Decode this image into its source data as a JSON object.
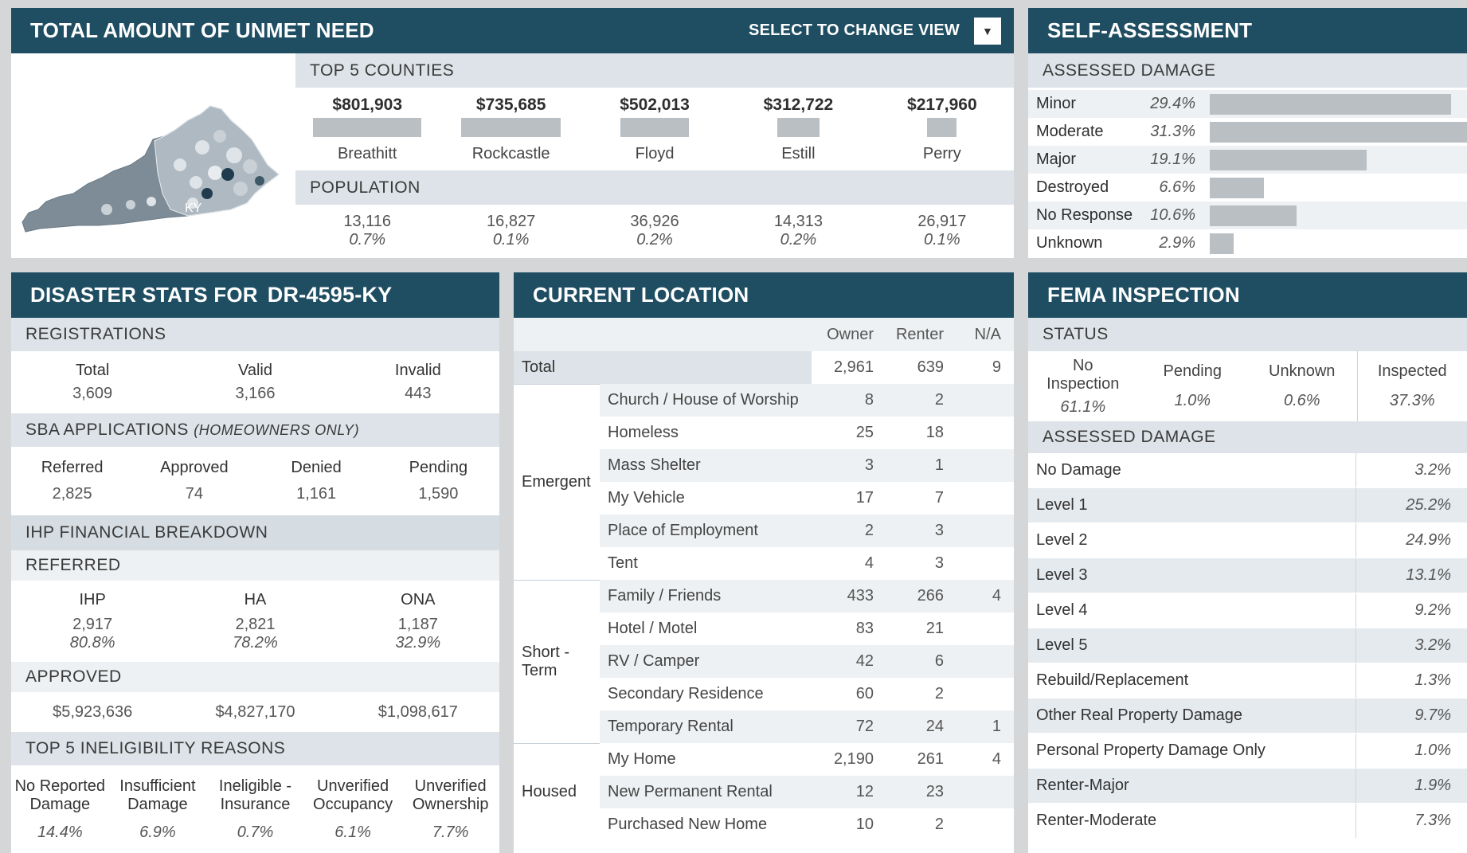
{
  "unmet": {
    "title": "TOTAL AMOUNT OF UNMET NEED",
    "view_label": "SELECT TO CHANGE VIEW",
    "map_label": "KY",
    "top_counties_label": "TOP 5 COUNTIES",
    "population_label": "POPULATION",
    "counties": [
      {
        "amount": "$801,903",
        "name": "Breathitt",
        "pop": "13,116",
        "pct": "0.7%",
        "share": 1.0
      },
      {
        "amount": "$735,685",
        "name": "Rockcastle",
        "pop": "16,827",
        "pct": "0.1%",
        "share": 0.92
      },
      {
        "amount": "$502,013",
        "name": "Floyd",
        "pop": "36,926",
        "pct": "0.2%",
        "share": 0.63
      },
      {
        "amount": "$312,722",
        "name": "Estill",
        "pop": "14,313",
        "pct": "0.2%",
        "share": 0.39
      },
      {
        "amount": "$217,960",
        "name": "Perry",
        "pop": "26,917",
        "pct": "0.1%",
        "share": 0.27
      }
    ]
  },
  "self": {
    "title": "SELF-ASSESSMENT",
    "sub": "ASSESSED DAMAGE",
    "rows": [
      {
        "label": "Minor",
        "pct": "29.4%",
        "value": 29.4
      },
      {
        "label": "Moderate",
        "pct": "31.3%",
        "value": 31.3
      },
      {
        "label": "Major",
        "pct": "19.1%",
        "value": 19.1
      },
      {
        "label": "Destroyed",
        "pct": "6.6%",
        "value": 6.6
      },
      {
        "label": "No Response",
        "pct": "10.6%",
        "value": 10.6
      },
      {
        "label": "Unknown",
        "pct": "2.9%",
        "value": 2.9
      }
    ]
  },
  "stats": {
    "title": "DISASTER STATS FOR",
    "disaster": "DR-4595-KY",
    "registrations": {
      "label": "REGISTRATIONS",
      "cols": [
        {
          "label": "Total",
          "value": "3,609"
        },
        {
          "label": "Valid",
          "value": "3,166"
        },
        {
          "label": "Invalid",
          "value": "443"
        }
      ]
    },
    "sba": {
      "label": "SBA APPLICATIONS",
      "qualifier": "(HOMEOWNERS ONLY)",
      "cols": [
        {
          "label": "Referred",
          "value": "2,825"
        },
        {
          "label": "Approved",
          "value": "74"
        },
        {
          "label": "Denied",
          "value": "1,161"
        },
        {
          "label": "Pending",
          "value": "1,590"
        }
      ]
    },
    "ihp": {
      "label": "IHP FINANCIAL BREAKDOWN",
      "referred_label": "REFERRED",
      "referred": [
        {
          "label": "IHP",
          "value": "2,917",
          "pct": "80.8%"
        },
        {
          "label": "HA",
          "value": "2,821",
          "pct": "78.2%"
        },
        {
          "label": "ONA",
          "value": "1,187",
          "pct": "32.9%"
        }
      ],
      "approved_label": "APPROVED",
      "approved": [
        "$5,923,636",
        "$4,827,170",
        "$1,098,617"
      ]
    },
    "inelig": {
      "label": "TOP 5 INELIGIBILITY REASONS",
      "cols": [
        {
          "l1": "No Reported",
          "l2": "Damage",
          "pct": "14.4%"
        },
        {
          "l1": "Insufficient",
          "l2": "Damage",
          "pct": "6.9%"
        },
        {
          "l1": "Ineligible -",
          "l2": "Insurance",
          "pct": "0.7%"
        },
        {
          "l1": "Unverified",
          "l2": "Occupancy",
          "pct": "6.1%"
        },
        {
          "l1": "Unverified",
          "l2": "Ownership",
          "pct": "7.7%"
        }
      ]
    }
  },
  "loc": {
    "title": "CURRENT LOCATION",
    "headers": [
      "Owner",
      "Renter",
      "N/A"
    ],
    "total": {
      "label": "Total",
      "owner": "2,961",
      "renter": "639",
      "na": "9"
    },
    "groups": [
      {
        "name": "Emergent",
        "rows": [
          {
            "label": "Church / House of Worship",
            "owner": "8",
            "renter": "2",
            "na": ""
          },
          {
            "label": "Homeless",
            "owner": "25",
            "renter": "18",
            "na": ""
          },
          {
            "label": "Mass Shelter",
            "owner": "3",
            "renter": "1",
            "na": ""
          },
          {
            "label": "My Vehicle",
            "owner": "17",
            "renter": "7",
            "na": ""
          },
          {
            "label": "Place of Employment",
            "owner": "2",
            "renter": "3",
            "na": ""
          },
          {
            "label": "Tent",
            "owner": "4",
            "renter": "3",
            "na": ""
          }
        ]
      },
      {
        "name": "Short - Term",
        "rows": [
          {
            "label": "Family / Friends",
            "owner": "433",
            "renter": "266",
            "na": "4"
          },
          {
            "label": "Hotel / Motel",
            "owner": "83",
            "renter": "21",
            "na": ""
          },
          {
            "label": "RV / Camper",
            "owner": "42",
            "renter": "6",
            "na": ""
          },
          {
            "label": "Secondary Residence",
            "owner": "60",
            "renter": "2",
            "na": ""
          },
          {
            "label": "Temporary Rental",
            "owner": "72",
            "renter": "24",
            "na": "1"
          }
        ]
      },
      {
        "name": "Housed",
        "rows": [
          {
            "label": "My Home",
            "owner": "2,190",
            "renter": "261",
            "na": "4"
          },
          {
            "label": "New Permanent Rental",
            "owner": "12",
            "renter": "23",
            "na": ""
          },
          {
            "label": "Purchased New Home",
            "owner": "10",
            "renter": "2",
            "na": ""
          }
        ]
      }
    ]
  },
  "fema": {
    "title": "FEMA INSPECTION",
    "status_label": "STATUS",
    "status": [
      {
        "l1": "No",
        "l2": "Inspection",
        "pct": "61.1%"
      },
      {
        "l1": "Pending",
        "l2": "",
        "pct": "1.0%"
      },
      {
        "l1": "Unknown",
        "l2": "",
        "pct": "0.6%"
      },
      {
        "l1": "Inspected",
        "l2": "",
        "pct": "37.3%"
      }
    ],
    "damage_label": "ASSESSED DAMAGE",
    "damage": [
      {
        "label": "No Damage",
        "pct": "3.2%"
      },
      {
        "label": "Level 1",
        "pct": "25.2%"
      },
      {
        "label": "Level 2",
        "pct": "24.9%"
      },
      {
        "label": "Level 3",
        "pct": "13.1%"
      },
      {
        "label": "Level 4",
        "pct": "9.2%"
      },
      {
        "label": "Level 5",
        "pct": "3.2%"
      },
      {
        "label": "Rebuild/Replacement",
        "pct": "1.3%"
      },
      {
        "label": "Other Real Property Damage",
        "pct": "9.7%"
      },
      {
        "label": "Personal Property Damage Only",
        "pct": "1.0%"
      },
      {
        "label": "Renter-Major",
        "pct": "1.9%"
      },
      {
        "label": "Renter-Moderate",
        "pct": "7.3%"
      }
    ]
  }
}
